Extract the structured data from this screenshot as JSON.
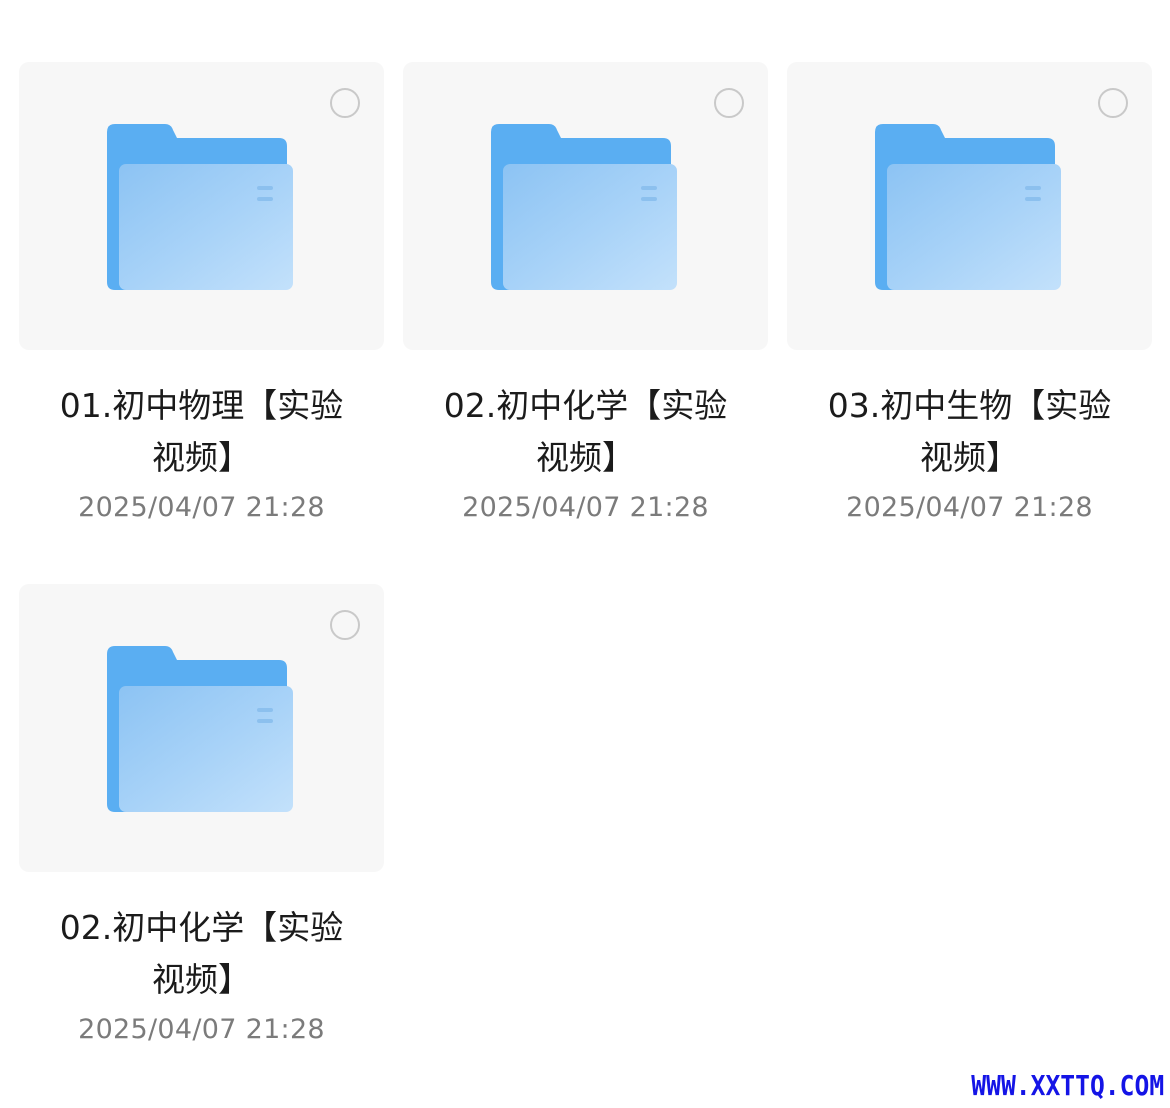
{
  "folders": [
    {
      "name_line1": "01.初中物理【实验",
      "name_line2": "视频】",
      "date": "2025/04/07 21:28",
      "icon": "folder-icon"
    },
    {
      "name_line1": "02.初中化学【实验",
      "name_line2": "视频】",
      "date": "2025/04/07 21:28",
      "icon": "folder-icon"
    },
    {
      "name_line1": "03.初中生物【实验",
      "name_line2": "视频】",
      "date": "2025/04/07 21:28",
      "icon": "folder-icon"
    },
    {
      "name_line1": "02.初中化学【实验",
      "name_line2": "视频】",
      "date": "2025/04/07 21:28",
      "icon": "folder-icon"
    }
  ],
  "watermark": "WWW.XXTTQ.COM",
  "colors": {
    "folder_back": "#5aaef2",
    "folder_front": "#a8d2f8",
    "watermark": "#1414e6"
  }
}
